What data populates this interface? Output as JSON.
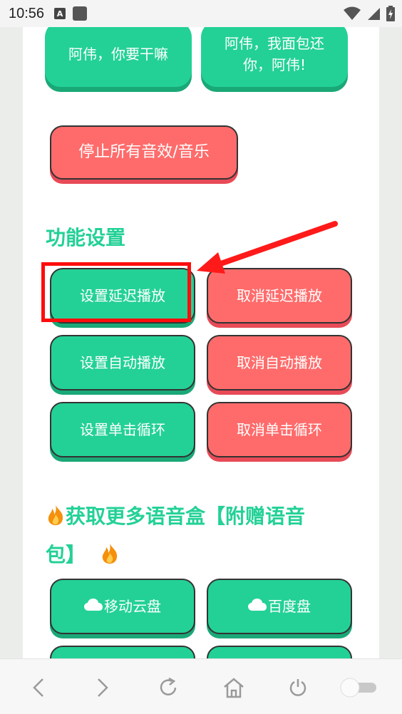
{
  "status_bar": {
    "time": "10:56",
    "a_badge": "A"
  },
  "buttons_top": {
    "left_label": "阿伟，你要干嘛",
    "right_label_line1": "阿伟，我面包还",
    "right_label_line2": "你，阿伟!"
  },
  "stop_button": {
    "label": "停止所有音效/音乐"
  },
  "settings_section": {
    "title": "功能设置",
    "set_delay": "设置延迟播放",
    "cancel_delay": "取消延迟播放",
    "set_auto": "设置自动播放",
    "cancel_auto": "取消自动播放",
    "set_loop": "设置单击循环",
    "cancel_loop": "取消单击循环"
  },
  "more_section": {
    "title_line1": "获取更多语音盒【附赠语音",
    "title_line2": "包】",
    "mobile_cloud": "移动云盘",
    "baidu_pan": "百度盘"
  },
  "icons": [
    "fire-icon",
    "cloud-icon",
    "back-icon",
    "forward-icon",
    "refresh-icon",
    "home-icon",
    "power-icon",
    "toggle-icon",
    "wifi-icon",
    "signal-icon",
    "battery-icon"
  ],
  "colors": {
    "green": "#23d196",
    "red": "#ff6b6b",
    "annotation": "#ff0c0c"
  }
}
